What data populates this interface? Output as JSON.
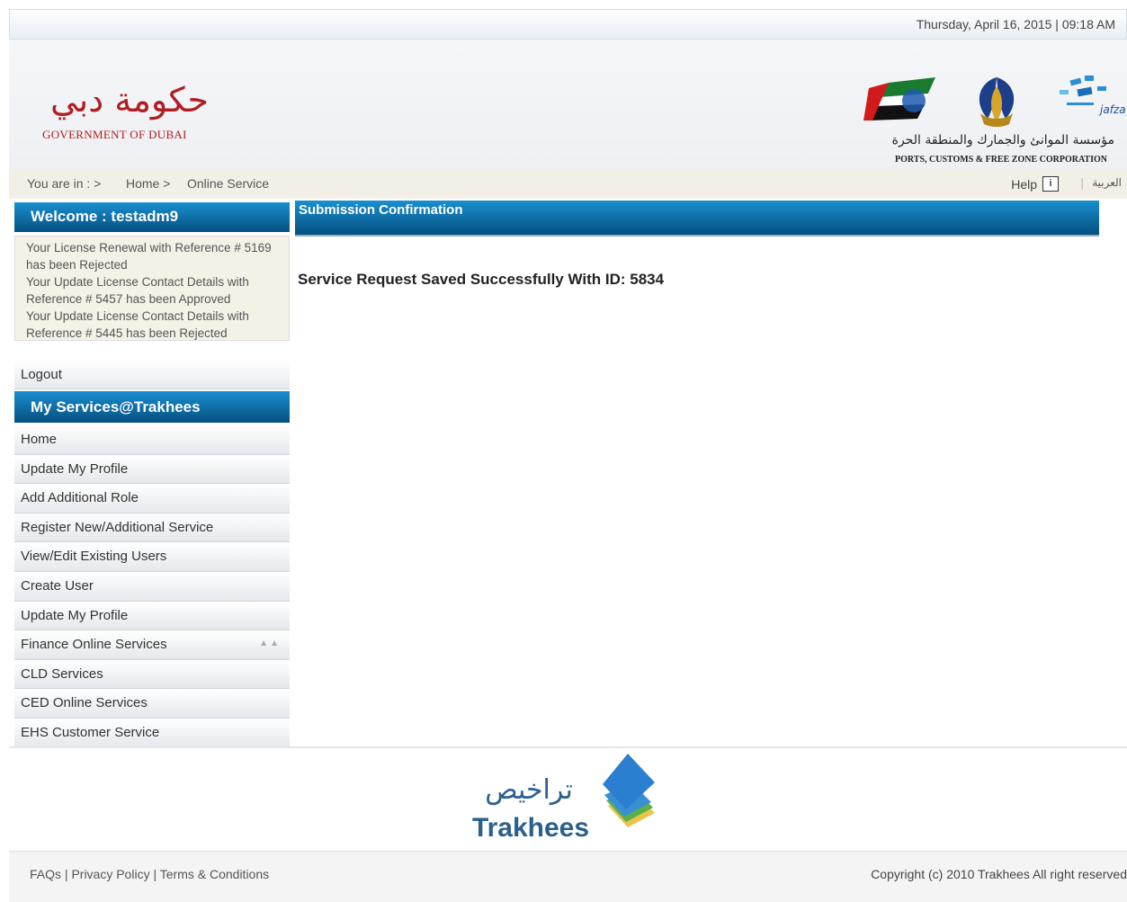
{
  "header": {
    "datetime": "Thursday, April 16, 2015 | 09:18 AM",
    "gov_logo_ar": "حكومة دبي",
    "gov_name": "GOVERNMENT OF DUBAI",
    "jafza_label": "jafza",
    "pcfc_ar": "مؤسسة الموانئ والجمارك والمنطقة الحرة",
    "pcfc_en": "PORTS, CUSTOMS & FREE ZONE CORPORATION"
  },
  "breadcrumb": {
    "prefix": "You are in :",
    "items": [
      "Home",
      "Online Service"
    ],
    "help": "Help",
    "help_icon": "i",
    "divider": "|",
    "language": "العربية"
  },
  "sidebar": {
    "welcome": "Welcome : testadm9",
    "notices": [
      "Your License Renewal with Reference # 5169 has been Rejected",
      "Your Update License Contact Details with Reference # 5457 has been Approved",
      "Your Update License Contact Details with Reference # 5445 has been Rejected"
    ],
    "logout": "Logout",
    "services_title": "My Services@Trakhees",
    "menu": [
      "Home",
      "Update My Profile",
      "Add Additional Role",
      "Register New/Additional Service",
      "View/Edit Existing Users",
      "Create User",
      "Update My Profile",
      "Finance Online Services",
      "CLD Services",
      "CED Online Services",
      "EHS Customer Service"
    ]
  },
  "main": {
    "title": "Submission Confirmation",
    "message": "Service Request Saved Successfully With ID: 5834"
  },
  "logo": {
    "ar": "تراخيص",
    "en": "Trakhees"
  },
  "footer": {
    "links": [
      "FAQs",
      "Privacy Policy",
      "Terms & Conditions"
    ],
    "separator": "|",
    "copyright": "Copyright (c) 2010 Trakhees All right reserved"
  },
  "colors": {
    "header_blue": "#04507f",
    "dubai_red": "#b01e23"
  }
}
